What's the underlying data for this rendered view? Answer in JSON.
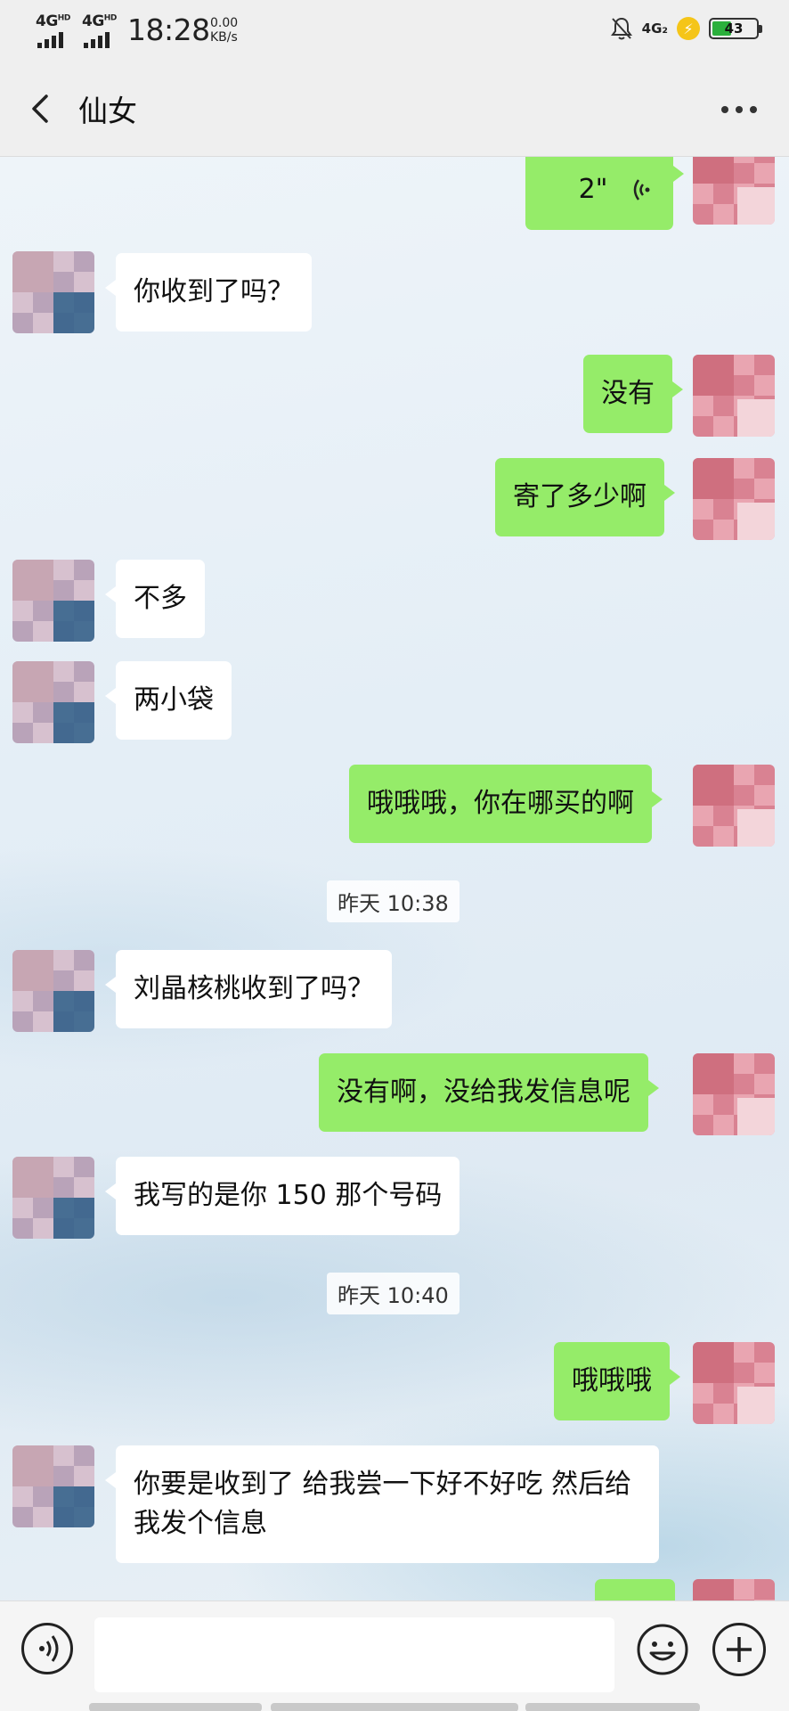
{
  "status_bar": {
    "sim1": "4G",
    "sim1_sup": "HD",
    "sim2": "4G",
    "sim2_sup": "HD",
    "time": "18:28",
    "speed_value": "0.00",
    "speed_unit": "KB/s",
    "network": "4G₂",
    "battery": "43",
    "battery_fraction": 0.43
  },
  "header": {
    "title": "仙女",
    "back_icon": "chevron-left-icon",
    "more_icon": "more-dots-icon"
  },
  "chat": {
    "voice_message": {
      "duration": "2\""
    },
    "messages": [
      {
        "side": "in",
        "text": "你收到了吗？"
      },
      {
        "side": "out",
        "text": "没有"
      },
      {
        "side": "out",
        "text": "寄了多少啊"
      },
      {
        "side": "in",
        "text": "不多"
      },
      {
        "side": "in",
        "text": "两小袋"
      },
      {
        "side": "out",
        "text": "哦哦哦，你在哪买的啊"
      },
      {
        "side": "in",
        "text": "刘晶核桃收到了吗？"
      },
      {
        "side": "out",
        "text": "没有啊，没给我发信息呢"
      },
      {
        "side": "in",
        "text": "我写的是你 150 那个号码"
      },
      {
        "side": "out",
        "text": "哦哦哦"
      },
      {
        "side": "in",
        "text": "你要是收到了   给我尝一下好不好吃   然后给我发个信息"
      }
    ],
    "timestamps": [
      "昨天 10:38",
      "昨天 10:40"
    ]
  },
  "input_bar": {
    "value": "",
    "voice_icon": "voice-input-icon",
    "emoji_icon": "emoji-icon",
    "add_icon": "add-icon"
  },
  "colors": {
    "outgoing_bubble": "#95ec69",
    "incoming_bubble": "#ffffff",
    "header_bg": "#efefef"
  }
}
